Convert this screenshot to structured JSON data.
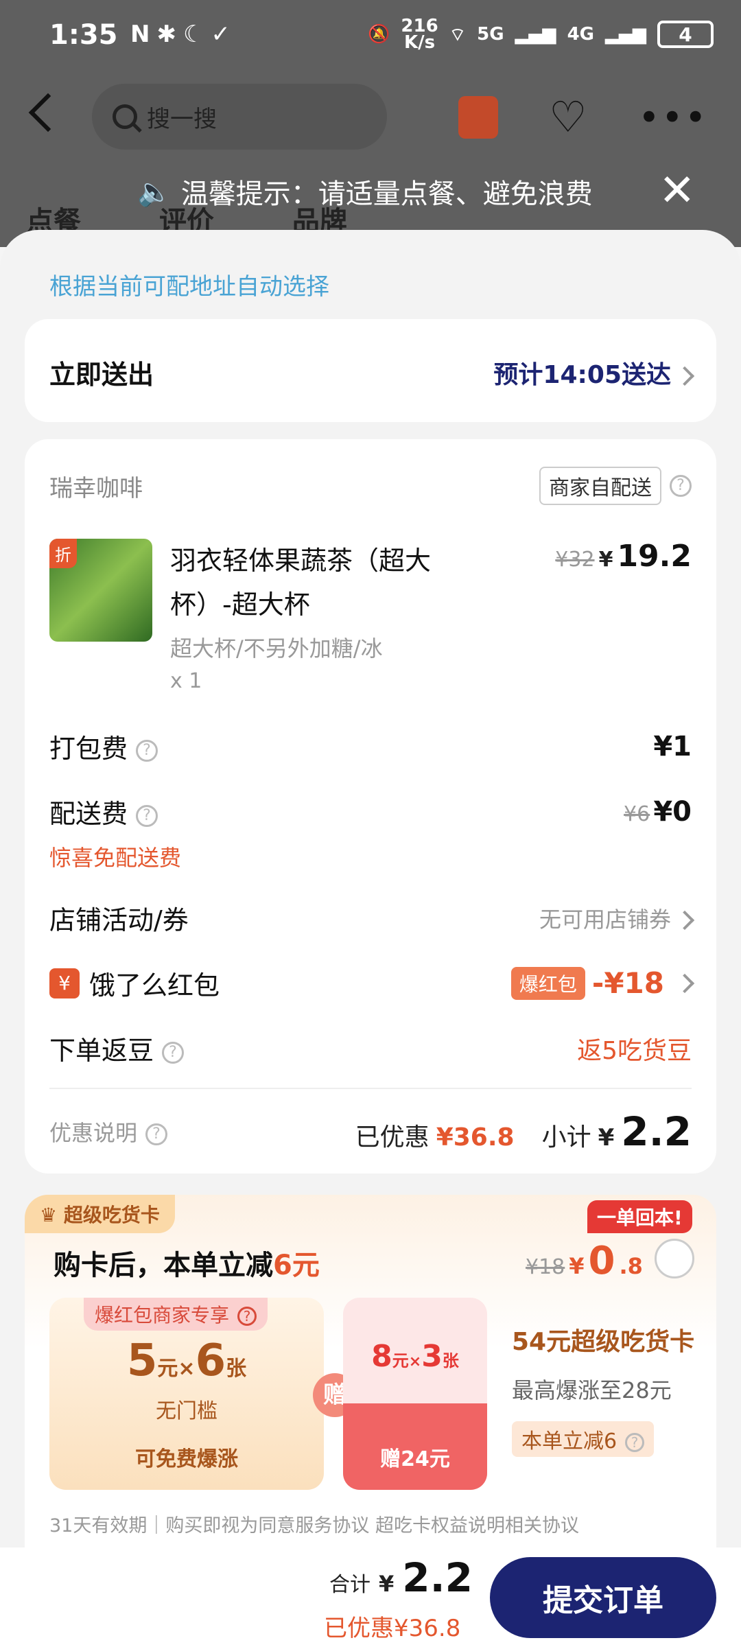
{
  "status": {
    "time": "1:35",
    "icons_left": "N✱☾✓",
    "net_speed_top": "216",
    "net_speed_bottom": "K/s",
    "signal5g": "5G",
    "signal4g": "4G",
    "battery": "4"
  },
  "nav": {
    "search_placeholder": "搜一搜"
  },
  "tabs": [
    "点餐",
    "评价",
    "品牌"
  ],
  "tip": {
    "text": "温馨提示：请适量点餐、避免浪费"
  },
  "delivery": {
    "address_note": "根据当前可配地址自动选择",
    "send_label": "立即送出",
    "eta": "预计14:05送达"
  },
  "shop": {
    "name": "瑞幸咖啡",
    "delivery_badge": "商家自配送"
  },
  "item": {
    "discount_tag": "折",
    "name": "羽衣轻体果蔬茶（超大杯）-超大杯",
    "spec": "超大杯/不另外加糖/冰",
    "qty": "x 1",
    "orig_price": "¥32",
    "price_symbol": "¥",
    "price": "19.2"
  },
  "fees": {
    "packing_label": "打包费",
    "packing_value": "¥1",
    "delivery_label": "配送费",
    "delivery_orig": "¥6",
    "delivery_value": "¥0",
    "delivery_note": "惊喜免配送费",
    "shop_activity_label": "店铺活动/券",
    "shop_activity_value": "无可用店铺券",
    "redpacket_icon": "¥",
    "redpacket_label": "饿了么红包",
    "redpacket_tag": "爆红包",
    "redpacket_value": "-¥18",
    "beans_label": "下单返豆",
    "beans_value": "返5吃货豆",
    "discount_note_label": "优惠说明",
    "saved_label": "已优惠",
    "saved_value": "¥36.8",
    "subtotal_label": "小计",
    "subtotal_symbol": "¥",
    "subtotal_value": "2.2"
  },
  "super_card": {
    "badge": "超级吃货卡",
    "headline_prefix": "购卡后，本单立减",
    "headline_amount": "6元",
    "orig": "¥18",
    "price_symbol": "¥",
    "price_int": "0",
    "price_dec": ".8",
    "back_tag": "一单回本!",
    "coupon1_title": "爆红包商家专享",
    "coupon1_amount": "5",
    "coupon1_unit": "元",
    "coupon1_times": "×",
    "coupon1_count": "6",
    "coupon1_count_unit": "张",
    "coupon1_cond": "无门槛",
    "coupon1_footer": "可免费爆涨",
    "gift_label": "赠",
    "coupon2_amount": "8",
    "coupon2_unit": "元",
    "coupon2_times": "×",
    "coupon2_count": "3",
    "coupon2_count_unit": "张",
    "coupon2_footer": "赠24元",
    "card_name": "54元超级吃货卡",
    "card_desc": "最高爆涨至28元",
    "card_tag": "本单立减6",
    "terms": "31天有效期｜购买即视为同意服务协议 超吃卡权益说明相关协议"
  },
  "bottom": {
    "total_label": "合计",
    "total_symbol": "¥",
    "total_value": "2.2",
    "saved": "已优惠¥36.8",
    "submit": "提交订单"
  }
}
